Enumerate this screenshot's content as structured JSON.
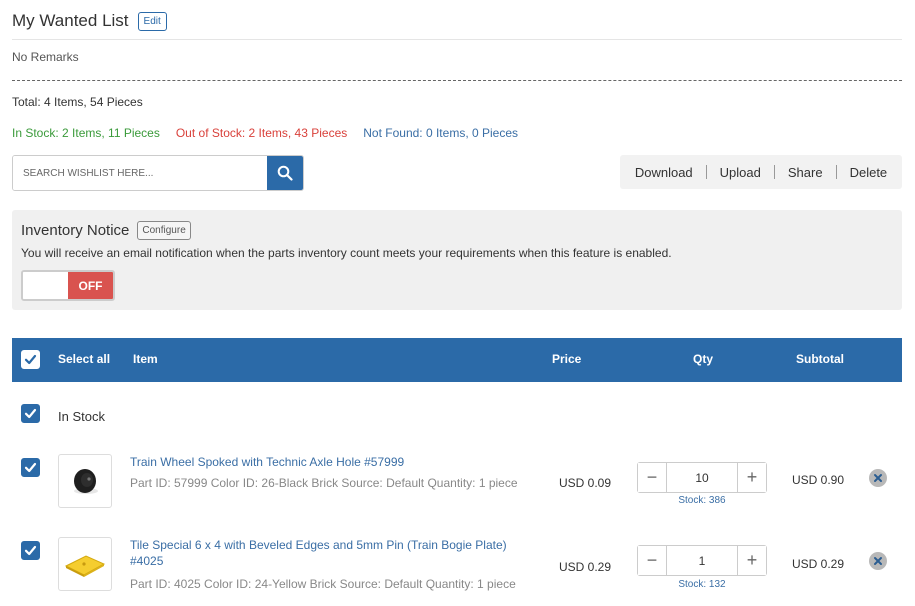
{
  "header": {
    "title": "My Wanted List",
    "edit_label": "Edit",
    "remarks": "No Remarks"
  },
  "summary": {
    "total": "Total: 4 Items, 54 Pieces",
    "in_stock": "In Stock: 2 Items, 11 Pieces",
    "out_of_stock": "Out of Stock: 2 Items, 43 Pieces",
    "not_found": "Not Found: 0 Items, 0 Pieces"
  },
  "search": {
    "placeholder": "SEARCH WISHLIST HERE..."
  },
  "actions": {
    "download": "Download",
    "upload": "Upload",
    "share": "Share",
    "delete": "Delete"
  },
  "notice": {
    "title": "Inventory Notice",
    "configure_label": "Configure",
    "text": "You will receive an email notification when the parts inventory count meets your requirements when this feature is enabled.",
    "toggle_label": "OFF"
  },
  "table": {
    "headers": {
      "select_all": "Select all",
      "item": "Item",
      "price": "Price",
      "qty": "Qty",
      "subtotal": "Subtotal"
    },
    "section_in_stock": "In Stock",
    "rows": [
      {
        "name": "Train Wheel Spoked with Technic Axle Hole #57999",
        "meta": "Part ID: 57999 Color ID: 26-Black Brick Source: Default Quantity: 1 piece",
        "price": "USD 0.09",
        "qty": "10",
        "stock": "Stock: 386",
        "subtotal": "USD 0.90"
      },
      {
        "name": "Tile Special 6 x 4 with Beveled Edges and 5mm Pin (Train Bogie Plate) #4025",
        "meta": "Part ID: 4025 Color ID: 24-Yellow Brick Source: Default Quantity: 1 piece",
        "price": "USD 0.29",
        "qty": "1",
        "stock": "Stock: 132",
        "subtotal": "USD 0.29"
      }
    ]
  },
  "colors": {
    "primary": "#2b6aa8",
    "in_stock": "#3a9a3a",
    "out_of_stock": "#d9413b",
    "not_found": "#3a6ea5",
    "toggle_off": "#d9534f"
  }
}
